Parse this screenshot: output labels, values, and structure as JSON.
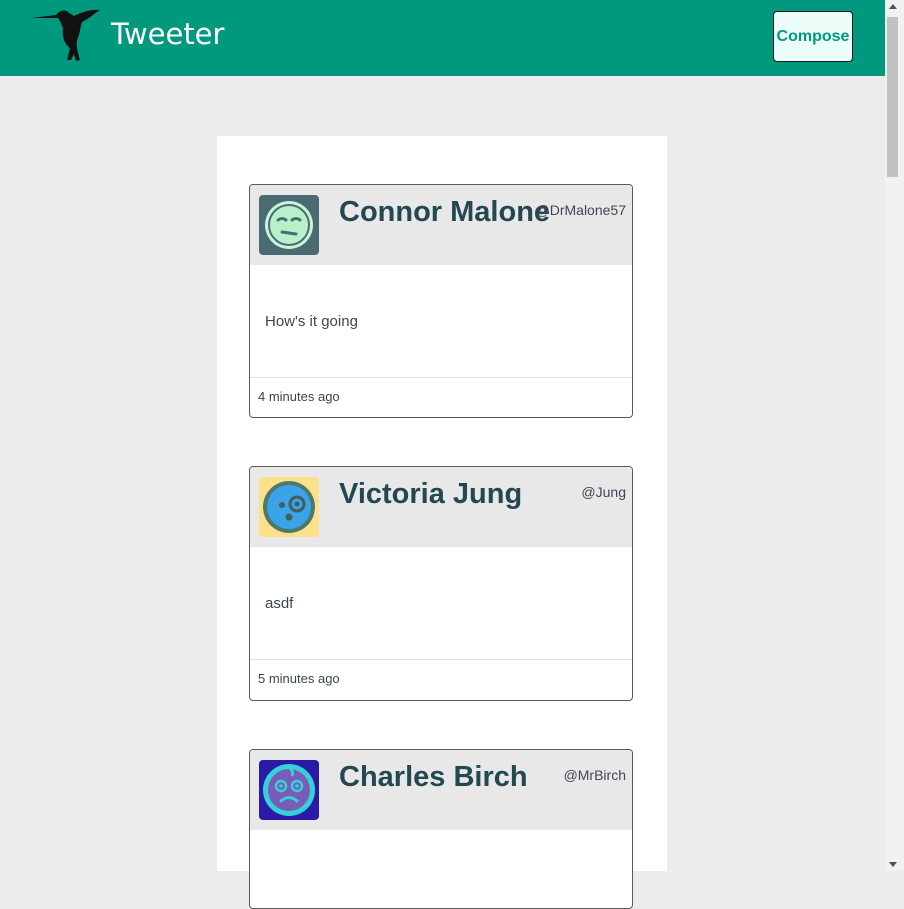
{
  "nav": {
    "brand": "Tweeter",
    "compose_label": "Compose",
    "logo_icon": "hummingbird-icon"
  },
  "colors": {
    "nav_bg": "#00997e",
    "page_bg": "#ececec",
    "header_bg": "#e8e8e8",
    "name_text": "#244751"
  },
  "tweets": [
    {
      "name": "Connor Malone",
      "handle": "@DrMalone57",
      "text": "How's it going",
      "time": "4 minutes ago",
      "avatar_icon": "smirk-face-avatar-icon"
    },
    {
      "name": "Victoria Jung",
      "handle": "@Jung",
      "text": "asdf",
      "time": "5 minutes ago",
      "avatar_icon": "monocle-face-avatar-icon"
    },
    {
      "name": "Charles Birch",
      "handle": "@MrBirch",
      "text": "",
      "time": "",
      "avatar_icon": "worried-face-avatar-icon"
    }
  ]
}
